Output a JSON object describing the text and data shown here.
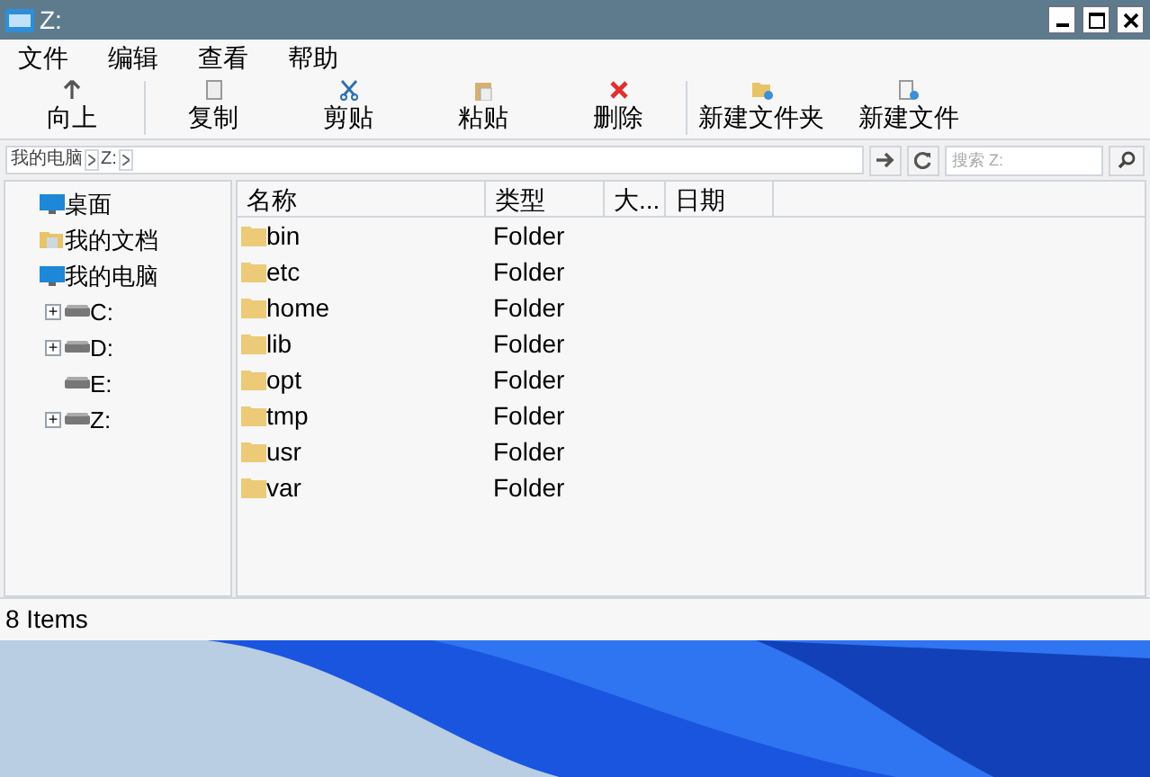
{
  "window": {
    "title": "Z:"
  },
  "menu": [
    "文件",
    "编辑",
    "查看",
    "帮助"
  ],
  "toolbar": [
    {
      "label": "向上",
      "kind": "up"
    },
    {
      "label": "复制",
      "kind": "copy"
    },
    {
      "label": "剪贴",
      "kind": "cut"
    },
    {
      "label": "粘贴",
      "kind": "paste"
    },
    {
      "label": "删除",
      "kind": "delete"
    },
    {
      "label": "新建文件夹",
      "kind": "newfolder"
    },
    {
      "label": "新建文件",
      "kind": "newfile"
    }
  ],
  "breadcrumb": [
    "我的电脑",
    "Z:"
  ],
  "search": {
    "placeholder": "搜索 Z:"
  },
  "tree": [
    {
      "label": "桌面",
      "kind": "desktop"
    },
    {
      "label": "我的文档",
      "kind": "documents"
    },
    {
      "label": "我的电脑",
      "kind": "computer",
      "children": [
        {
          "label": "C:",
          "kind": "drive",
          "expander": "+"
        },
        {
          "label": "D:",
          "kind": "drive",
          "expander": "+"
        },
        {
          "label": "E:",
          "kind": "drive"
        },
        {
          "label": "Z:",
          "kind": "drive",
          "expander": "+"
        }
      ]
    }
  ],
  "table": {
    "columns": [
      "名称",
      "类型",
      "大...",
      "日期"
    ],
    "rows": [
      {
        "name": "bin",
        "type": "Folder"
      },
      {
        "name": "etc",
        "type": "Folder"
      },
      {
        "name": "home",
        "type": "Folder"
      },
      {
        "name": "lib",
        "type": "Folder"
      },
      {
        "name": "opt",
        "type": "Folder"
      },
      {
        "name": "tmp",
        "type": "Folder"
      },
      {
        "name": "usr",
        "type": "Folder"
      },
      {
        "name": "var",
        "type": "Folder"
      }
    ]
  },
  "status_bar": "8 Items"
}
